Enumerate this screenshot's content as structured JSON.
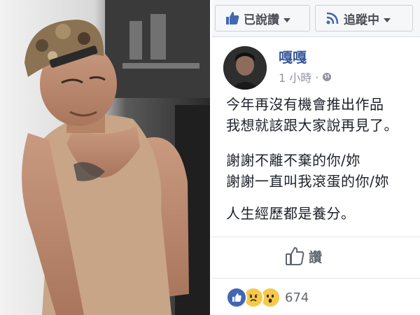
{
  "page_header": {
    "liked_label": "已說讚",
    "follow_label": "追蹤中"
  },
  "post": {
    "author": "嘎嘎",
    "time": "1 小時",
    "dot": "·",
    "lines": [
      "今年再沒有機會推出作品",
      "我想就該跟大家說再見了。",
      "謝謝不離不棄的你/妳",
      "謝謝一直叫我滾蛋的你/妳",
      "人生經歷都是養分。"
    ],
    "like_label": "讚",
    "reaction_count": "674",
    "reactions": [
      "like-icon",
      "sad-icon",
      "wow-icon"
    ]
  },
  "colors": {
    "fb_blue": "#365899",
    "like_blue": "#4267b2",
    "sad_yellow": "#f7c94b"
  }
}
